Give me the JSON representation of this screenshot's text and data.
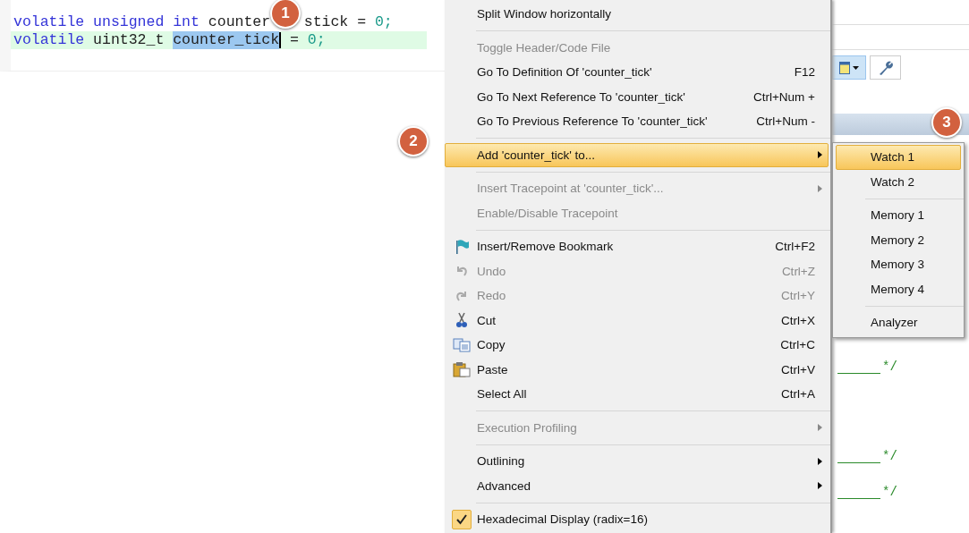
{
  "editor": {
    "lines": [
      {
        "highlighted": false,
        "tokens": [
          {
            "text": "volatile",
            "kind": "keyword"
          },
          {
            "text": "unsigned",
            "kind": "keyword"
          },
          {
            "text": "int",
            "kind": "keyword"
          },
          {
            "text": "counter",
            "kind": "plain"
          },
          {
            "text": "stick",
            "kind": "plain",
            "gap": true
          },
          {
            "text": "=",
            "kind": "plain"
          },
          {
            "text": "0;",
            "kind": "number"
          }
        ]
      },
      {
        "highlighted": true,
        "tokens": [
          {
            "text": "volatile",
            "kind": "keyword"
          },
          {
            "text": "uint32_t",
            "kind": "plain"
          },
          {
            "text": "counter_tick",
            "kind": "plain",
            "selected": true,
            "caret": true
          },
          {
            "text": "=",
            "kind": "plain"
          },
          {
            "text": "0;",
            "kind": "number"
          }
        ]
      }
    ]
  },
  "context_menu": {
    "items": [
      {
        "kind": "item",
        "label": "Split Window horizontally",
        "disabled": false,
        "selected": false
      },
      {
        "kind": "separator"
      },
      {
        "kind": "item",
        "label": "Toggle Header/Code File",
        "disabled": true,
        "selected": false
      },
      {
        "kind": "item",
        "label": "Go To Definition Of 'counter_tick'",
        "shortcut": "F12",
        "disabled": false,
        "selected": false
      },
      {
        "kind": "item",
        "label": "Go To Next Reference To 'counter_tick'",
        "shortcut": "Ctrl+Num +",
        "disabled": false,
        "selected": false
      },
      {
        "kind": "item",
        "label": "Go To Previous Reference To 'counter_tick'",
        "shortcut": "Ctrl+Num -",
        "disabled": false,
        "selected": false
      },
      {
        "kind": "separator"
      },
      {
        "kind": "item",
        "label": "Add 'counter_tick' to...",
        "submenu": true,
        "disabled": false,
        "selected": true
      },
      {
        "kind": "separator"
      },
      {
        "kind": "item",
        "label": "Insert Tracepoint at 'counter_tick'...",
        "submenu": true,
        "disabled": true,
        "selected": false
      },
      {
        "kind": "item",
        "label": "Enable/Disable Tracepoint",
        "disabled": true,
        "selected": false
      },
      {
        "kind": "separator"
      },
      {
        "kind": "bookmark",
        "label": "Insert/Remove Bookmark",
        "shortcut": "Ctrl+F2",
        "disabled": false,
        "selected": false
      },
      {
        "kind": "undo",
        "label": "Undo",
        "shortcut": "Ctrl+Z",
        "disabled": true,
        "selected": false
      },
      {
        "kind": "redo",
        "label": "Redo",
        "shortcut": "Ctrl+Y",
        "disabled": true,
        "selected": false
      },
      {
        "kind": "cut",
        "label": "Cut",
        "shortcut": "Ctrl+X",
        "disabled": false,
        "selected": false
      },
      {
        "kind": "copy",
        "label": "Copy",
        "shortcut": "Ctrl+C",
        "disabled": false,
        "selected": false
      },
      {
        "kind": "paste",
        "label": "Paste",
        "shortcut": "Ctrl+V",
        "disabled": false,
        "selected": false
      },
      {
        "kind": "item",
        "label": "Select All",
        "shortcut": "Ctrl+A",
        "disabled": false,
        "selected": false
      },
      {
        "kind": "separator"
      },
      {
        "kind": "item",
        "label": "Execution Profiling",
        "submenu": true,
        "disabled": true,
        "selected": false
      },
      {
        "kind": "separator"
      },
      {
        "kind": "item",
        "label": "Outlining",
        "submenu": true,
        "disabled": false,
        "selected": false
      },
      {
        "kind": "item",
        "label": "Advanced",
        "submenu": true,
        "disabled": false,
        "selected": false
      },
      {
        "kind": "separator"
      },
      {
        "kind": "item",
        "label": "Hexadecimal Display (radix=16)",
        "checked": true,
        "disabled": false,
        "selected": false
      }
    ]
  },
  "submenu": {
    "items": [
      {
        "kind": "item",
        "label": "Watch 1",
        "selected": true
      },
      {
        "kind": "item",
        "label": "Watch 2",
        "selected": false
      },
      {
        "kind": "separator"
      },
      {
        "kind": "item",
        "label": "Memory 1",
        "selected": false
      },
      {
        "kind": "item",
        "label": "Memory 2",
        "selected": false
      },
      {
        "kind": "item",
        "label": "Memory 3",
        "selected": false
      },
      {
        "kind": "item",
        "label": "Memory 4",
        "selected": false
      },
      {
        "kind": "separator"
      },
      {
        "kind": "item",
        "label": "Analyzer",
        "selected": false
      }
    ]
  },
  "background_editor": {
    "comments": [
      {
        "text": "*/"
      },
      {
        "text": "*/"
      },
      {
        "text": "*/"
      }
    ]
  },
  "callouts": [
    "1",
    "2",
    "3"
  ]
}
